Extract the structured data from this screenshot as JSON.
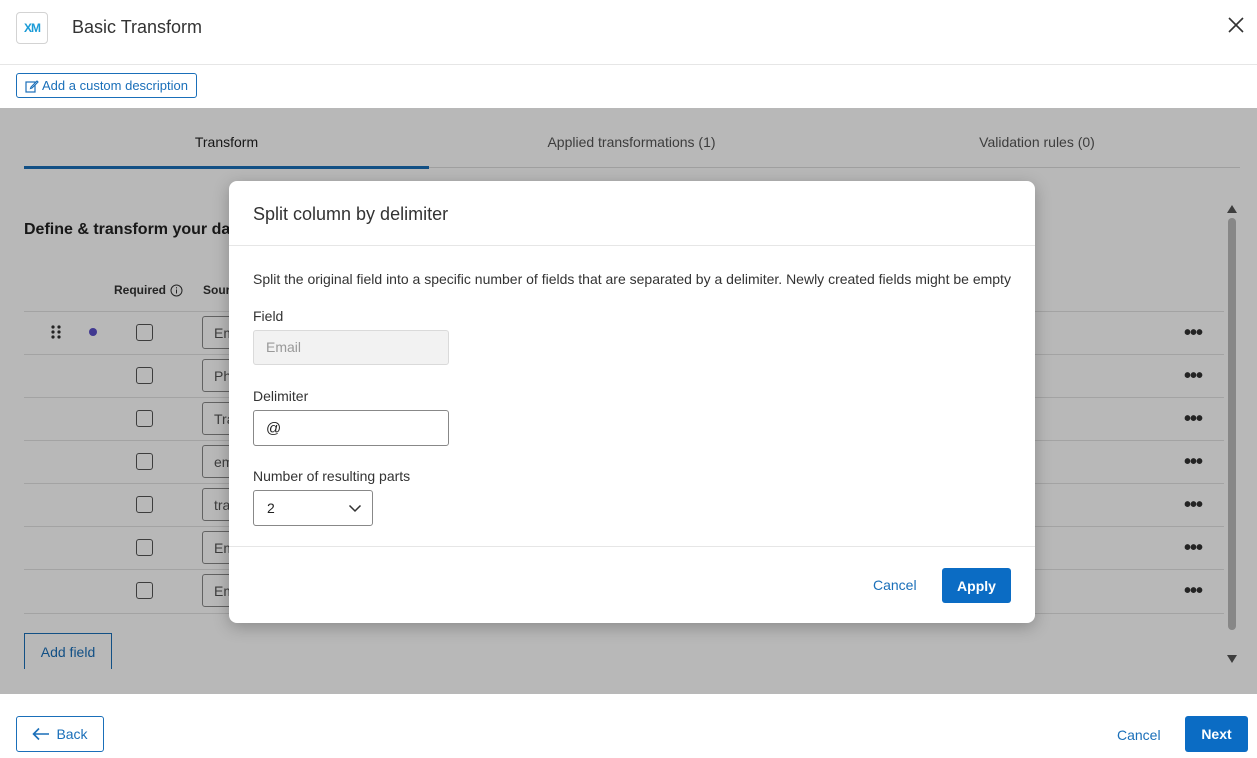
{
  "header": {
    "logo_text": "XM",
    "title": "Basic Transform",
    "description_button": "Add a custom description"
  },
  "tabs": [
    {
      "label": "Transform",
      "active": true
    },
    {
      "label": "Applied transformations (1)",
      "active": false
    },
    {
      "label": "Validation rules (0)",
      "active": false
    }
  ],
  "section": {
    "title": "Define & transform your da",
    "columns": {
      "required": "Required",
      "source": "Sour"
    }
  },
  "rows": [
    {
      "source": "Em",
      "required": false
    },
    {
      "source": "Ph",
      "required": false
    },
    {
      "source": "Tra",
      "required": false
    },
    {
      "source": "em",
      "required": false
    },
    {
      "source": "tra",
      "required": false
    },
    {
      "source": "Em",
      "required": false
    },
    {
      "source": "Em",
      "required": false
    }
  ],
  "add_field_label": "Add field",
  "footer": {
    "back_label": "Back",
    "cancel_label": "Cancel",
    "next_label": "Next"
  },
  "modal": {
    "title": "Split column by delimiter",
    "description": "Split the original field into a specific number of fields that are separated by a delimiter. Newly created fields might be empty",
    "field_label": "Field",
    "field_placeholder": "Email",
    "delimiter_label": "Delimiter",
    "delimiter_value": "@",
    "parts_label": "Number of resulting parts",
    "parts_value": "2",
    "cancel_label": "Cancel",
    "apply_label": "Apply"
  },
  "colors": {
    "accent": "#1a6fb9",
    "primary_button": "#0b6cc4",
    "row_indicator": "#5b4fc9"
  }
}
